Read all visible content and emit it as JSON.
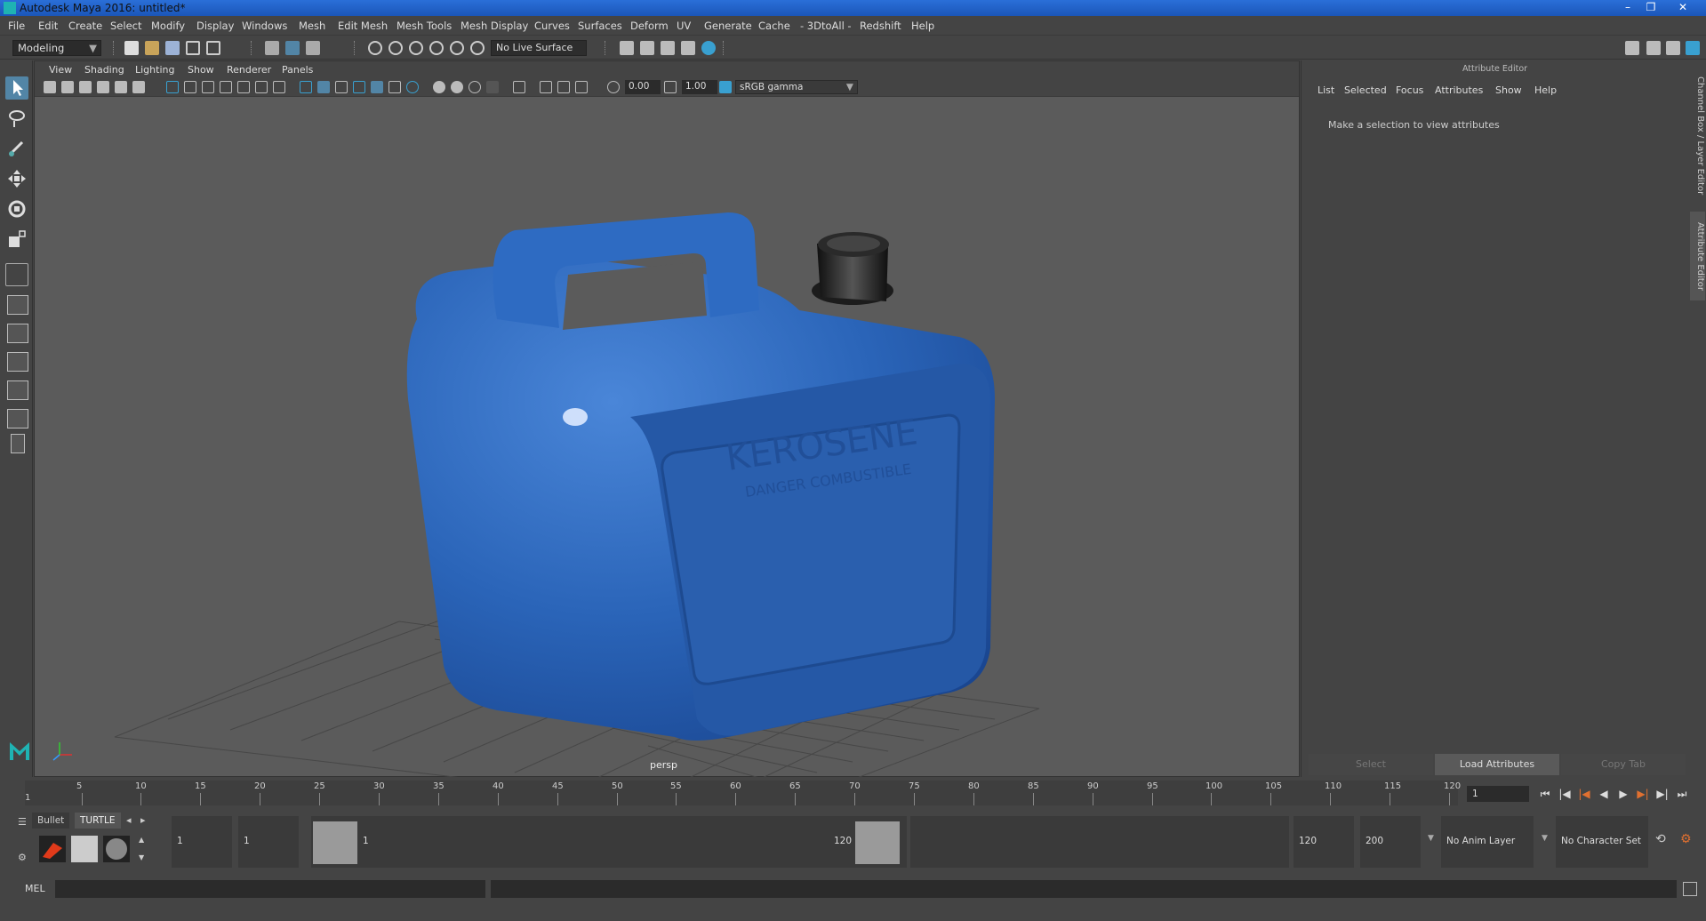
{
  "window": {
    "title": "Autodesk Maya 2016: untitled*",
    "controls": [
      "–",
      "❐",
      "✕"
    ]
  },
  "menubar": [
    "File",
    "Edit",
    "Create",
    "Select",
    "Modify",
    "Display",
    "Windows",
    "Mesh",
    "Edit Mesh",
    "Mesh Tools",
    "Mesh Display",
    "Curves",
    "Surfaces",
    "Deform",
    "UV",
    "Generate",
    "Cache",
    "- 3DtoAll -",
    "Redshift",
    "Help"
  ],
  "statusline": {
    "mode": "Modeling",
    "live_surface": "No Live Surface"
  },
  "viewport": {
    "menus": [
      "View",
      "Shading",
      "Lighting",
      "Show",
      "Renderer",
      "Panels"
    ],
    "exposure": "0.00",
    "gamma_value": "1.00",
    "color_space": "sRGB gamma",
    "camera": "persp",
    "object_text": "KEROSENE",
    "object_subtext": "DANGER     COMBUSTIBLE",
    "colors": {
      "jerrycan": "#2a64b8",
      "cap": "#1c1c1c",
      "background": "#5b5b5b"
    }
  },
  "attribute_editor": {
    "title": "Attribute Editor",
    "menus": [
      "List",
      "Selected",
      "Focus",
      "Attributes",
      "Show",
      "Help"
    ],
    "message": "Make a selection to view attributes",
    "buttons": {
      "select": "Select",
      "load": "Load Attributes",
      "copy": "Copy Tab"
    },
    "side_tabs": [
      "Channel Box / Layer Editor",
      "Attribute Editor"
    ]
  },
  "time_slider": {
    "ticks": [
      "5",
      "10",
      "15",
      "20",
      "25",
      "30",
      "35",
      "40",
      "45",
      "50",
      "55",
      "60",
      "65",
      "70",
      "75",
      "80",
      "85",
      "90",
      "95",
      "100",
      "105",
      "110",
      "115",
      "120"
    ],
    "start_marker": "1",
    "current_frame": "1",
    "playback": [
      "⏮",
      "⏭",
      "|◀",
      "◀",
      "▶",
      "▶|",
      "⏭",
      "⏭"
    ]
  },
  "range_slider": {
    "shelf_tabs": [
      "Bullet",
      "TURTLE"
    ],
    "start": "1",
    "anim_start": "1",
    "range_start_label": "1",
    "range_end_label": "120",
    "anim_end": "120",
    "end": "200",
    "anim_layer": "No Anim Layer",
    "character_set": "No Character Set"
  },
  "cmdline": {
    "label": "MEL"
  }
}
